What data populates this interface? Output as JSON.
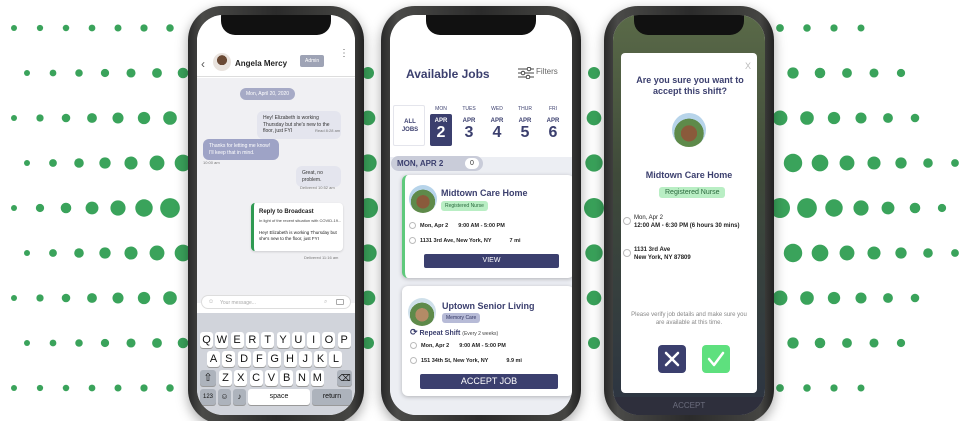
{
  "colors": {
    "dot": "#3aa35b",
    "navy": "#3b3f6e",
    "green_badge": "#b9eec4",
    "accent_green": "#5ee07e"
  },
  "chat": {
    "contact_name": "Angela Mercy",
    "role_tag": "Admin",
    "date_chip": "Mon, April 20, 2020",
    "messages": [
      {
        "text": "Hey! Elizabeth is working Thursday but she's new to the floor, just FYI",
        "meta": "Read 8:28 am"
      },
      {
        "text": "Thanks for letting me know! I'll keep that in mind.",
        "meta": "10:00 am"
      },
      {
        "text": "Great, no problem.",
        "meta": "Delivered 10:52 am"
      }
    ],
    "broadcast": {
      "title": "Reply to Broadcast",
      "preview": "In light of the recent situation with COVID-19...",
      "body": "Hey! Elizabeth is working Thursday but she's new to the floor, just FYI",
      "meta": "Delivered 11:16 am"
    },
    "composer_placeholder": "Your message...",
    "keyboard": {
      "row1": [
        "Q",
        "W",
        "E",
        "R",
        "T",
        "Y",
        "U",
        "I",
        "O",
        "P"
      ],
      "row2": [
        "A",
        "S",
        "D",
        "F",
        "G",
        "H",
        "J",
        "K",
        "L"
      ],
      "row3": [
        "Z",
        "X",
        "C",
        "V",
        "B",
        "N",
        "M"
      ],
      "numbers_key": "123",
      "space_key": "space",
      "return_key": "return"
    }
  },
  "jobs": {
    "title": "Available Jobs",
    "filters_label": "Filters",
    "all_jobs": "ALL JOBS",
    "days": [
      {
        "dow": "MON",
        "month": "APR",
        "num": "2"
      },
      {
        "dow": "TUES",
        "month": "APR",
        "num": "3"
      },
      {
        "dow": "WED",
        "month": "APR",
        "num": "4"
      },
      {
        "dow": "THUR",
        "month": "APR",
        "num": "5"
      },
      {
        "dow": "FRI",
        "month": "APR",
        "num": "6"
      }
    ],
    "section_label": "MON, APR 2",
    "section_count": "0",
    "cards": [
      {
        "name": "Midtown Care Home",
        "badge": "Registered Nurse",
        "date": "Mon, Apr 2",
        "time": "9:00 AM - 5:00 PM",
        "address": "1131 3rd Ave, New York, NY",
        "distance": "7 mi",
        "button": "VIEW"
      },
      {
        "name": "Uptown Senior Living",
        "badge": "Memory Care",
        "repeat": "Repeat Shift",
        "repeat_note": "(Every 2 weeks)",
        "date": "Mon, Apr 2",
        "time": "9:00 AM - 5:00 PM",
        "address": "151 34th St, New York, NY",
        "distance": "9.9 mi",
        "button": "ACCEPT JOB"
      }
    ]
  },
  "confirm": {
    "close": "X",
    "question": "Are you sure you want to accept this shift?",
    "facility": "Midtown Care Home",
    "badge": "Registered Nurse",
    "date": "Mon, Apr 2",
    "time": "12:00 AM - 6:30 PM (6 hours 30 mins)",
    "address_line1": "1131 3rd Ave",
    "address_line2": "New York, NY 87809",
    "note": "Please verify job details and make sure you are available at this time.",
    "footer": "ACCEPT"
  }
}
